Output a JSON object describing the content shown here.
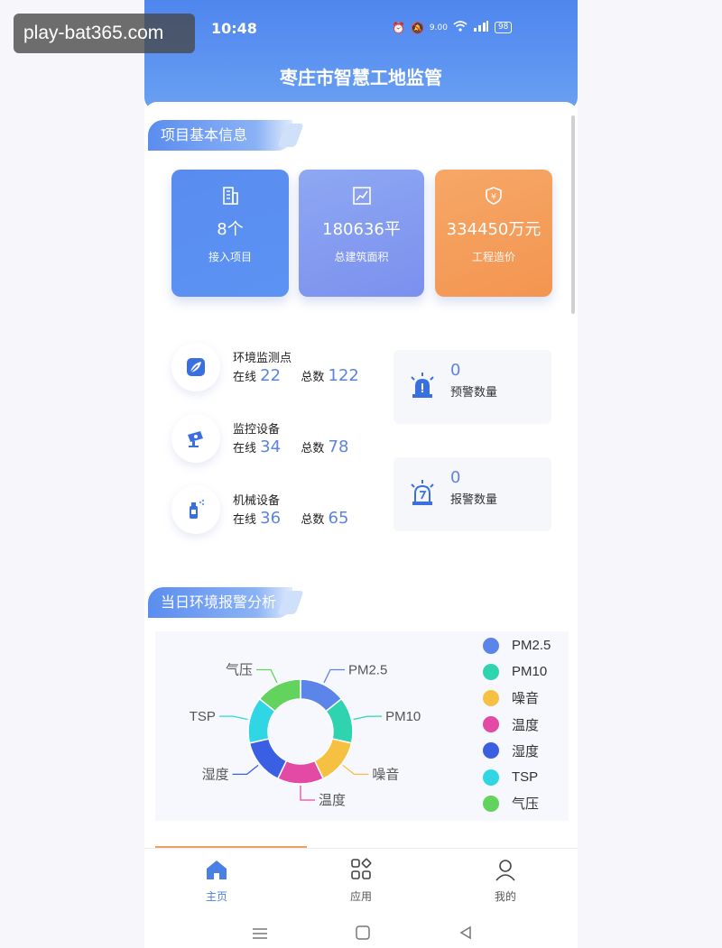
{
  "watermark": "play-bat365.com",
  "status": {
    "time": "10:48",
    "net_speed": "9.00",
    "battery": "98"
  },
  "app_title": "枣庄市智慧工地监管",
  "sections": {
    "basic_info": "项目基本信息",
    "env_alarm": "当日环境报警分析"
  },
  "cards": [
    {
      "value": "8个",
      "label": "接入项目",
      "icon": "building-icon",
      "color": "#5b8ff0"
    },
    {
      "value": "180636平",
      "label": "总建筑面积",
      "icon": "chart-icon",
      "color": "#7f9af0"
    },
    {
      "value": "334450万元",
      "label": "工程造价",
      "icon": "shield-money-icon",
      "color": "#f59a56"
    }
  ],
  "stats": [
    {
      "name": "环境监测点",
      "online_label": "在线",
      "online": "22",
      "total_label": "总数",
      "total": "122",
      "icon": "leaf-icon"
    },
    {
      "name": "监控设备",
      "online_label": "在线",
      "online": "34",
      "total_label": "总数",
      "total": "78",
      "icon": "camera-icon"
    },
    {
      "name": "机械设备",
      "online_label": "在线",
      "online": "36",
      "total_label": "总数",
      "total": "65",
      "icon": "spray-icon"
    }
  ],
  "alerts": [
    {
      "count": "0",
      "label": "预警数量",
      "icon": "siren-icon"
    },
    {
      "count": "0",
      "label": "报警数量",
      "icon": "alarm-icon"
    }
  ],
  "chart_data": {
    "type": "pie",
    "donut": true,
    "categories": [
      "PM2.5",
      "PM10",
      "噪音",
      "温度",
      "湿度",
      "TSP",
      "气压"
    ],
    "values": [
      1,
      1,
      1,
      1,
      1,
      1,
      1
    ],
    "colors": [
      "#5b85e8",
      "#2fd3b0",
      "#f6c143",
      "#e34aa6",
      "#3a5fe3",
      "#30d6e3",
      "#62d45e"
    ],
    "legend_placement": "right"
  },
  "tabs": [
    {
      "label": "主页",
      "icon": "home-icon",
      "active": true
    },
    {
      "label": "应用",
      "icon": "apps-icon",
      "active": false
    },
    {
      "label": "我的",
      "icon": "user-icon",
      "active": false
    }
  ]
}
